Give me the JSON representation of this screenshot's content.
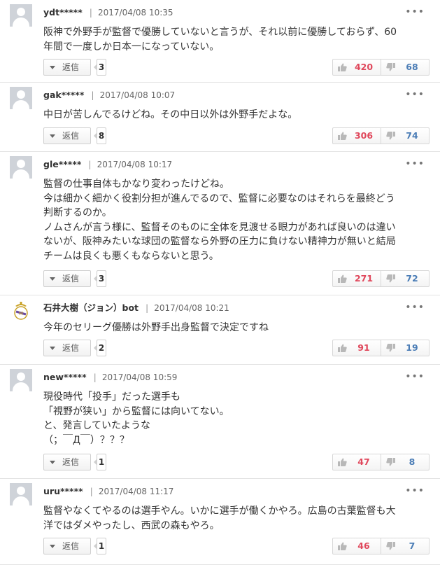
{
  "reply_label": "返信",
  "comments": [
    {
      "user": "ydt*****",
      "date": "2017/04/08 10:35",
      "lines": [
        "阪神で外野手が監督で優勝していないと言うが、それ以前に優勝しておらず、60",
        "年間で一度しか日本一になっていない。"
      ],
      "reply_count": "3",
      "likes": "420",
      "dislikes": "68",
      "avatar": "default"
    },
    {
      "user": "gak*****",
      "date": "2017/04/08 10:07",
      "lines": [
        "中日が苦しんでるけどね。その中日以外は外野手だよな。"
      ],
      "reply_count": "8",
      "likes": "306",
      "dislikes": "74",
      "avatar": "default"
    },
    {
      "user": "gle*****",
      "date": "2017/04/08 10:17",
      "lines": [
        "監督の仕事自体もかなり変わったけどね。",
        "今は細かく細かく役割分担が進んでるので、監督に必要なのはそれらを最終どう",
        "判断するのか。",
        "ノムさんが言う様に、監督そのものに全体を見渡せる眼力があれば良いのは違い",
        "ないが、阪神みたいな球団の監督なら外野の圧力に負けない精神力が無いと結局",
        "チームは良くも悪くもならないと思う。"
      ],
      "reply_count": "3",
      "likes": "271",
      "dislikes": "72",
      "avatar": "default"
    },
    {
      "user": "石井大樹（ジョン）bot",
      "date": "2017/04/08 10:21",
      "lines": [
        "今年のセリーグ優勝は外野手出身監督で決定ですね"
      ],
      "reply_count": "2",
      "likes": "91",
      "dislikes": "19",
      "avatar": "crest"
    },
    {
      "user": "new*****",
      "date": "2017/04/08 10:59",
      "lines": [
        "現役時代「投手」だった選手も",
        "「視野が狭い」から監督には向いてない。",
        "と、発言していたような",
        "（；￣Д￣）？？？"
      ],
      "reply_count": "1",
      "likes": "47",
      "dislikes": "8",
      "avatar": "default"
    },
    {
      "user": "uru*****",
      "date": "2017/04/08 11:17",
      "lines": [
        "監督やなくてやるのは選手やん。いかに選手が働くかやろ。広島の古葉監督も大",
        "洋ではダメやったし、西武の森もやろ。"
      ],
      "reply_count": "1",
      "likes": "46",
      "dislikes": "7",
      "avatar": "default"
    }
  ],
  "colors": {
    "like": "#e0485c",
    "dislike": "#4b7db6",
    "divider": "#e3e3e3",
    "avatar_bg": "#cfd3d9"
  },
  "icons": {
    "more": "more-dots-icon",
    "like": "thumbs-up-icon",
    "dislike": "thumbs-down-icon",
    "reply": "caret-down-icon"
  }
}
